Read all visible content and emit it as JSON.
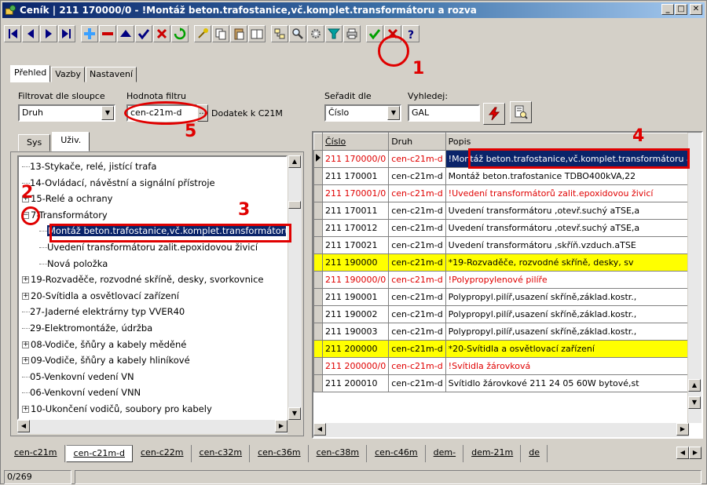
{
  "window": {
    "title": "Ceník | 211 170000/0 - !Montáž beton.trafostanice,vč.komplet.transformátoru a rozva",
    "title_color": "#0a246a",
    "buttons": [
      "minimize",
      "maximize",
      "close"
    ]
  },
  "toolbar": {
    "buttons": [
      {
        "name": "first-record-icon"
      },
      {
        "name": "prev-record-icon"
      },
      {
        "name": "next-record-icon"
      },
      {
        "name": "last-record-icon"
      },
      {
        "name": "add-record-icon"
      },
      {
        "name": "delete-record-icon"
      },
      {
        "name": "up-icon"
      },
      {
        "name": "confirm-icon"
      },
      {
        "name": "cancel-icon"
      },
      {
        "name": "refresh-icon"
      },
      {
        "name": "tool-icon"
      },
      {
        "name": "copy-icon"
      },
      {
        "name": "paste-icon"
      },
      {
        "name": "book-icon"
      },
      {
        "name": "tree-sync-icon"
      },
      {
        "name": "search-icon"
      },
      {
        "name": "settings-icon"
      },
      {
        "name": "filter-icon"
      },
      {
        "name": "print-icon"
      },
      {
        "name": "ok-icon"
      },
      {
        "name": "close-x-icon"
      },
      {
        "name": "help-icon"
      }
    ]
  },
  "annotations": {
    "m1": "1",
    "m2": "2",
    "m3": "3",
    "m4": "4",
    "m5": "5",
    "color": "#e00000"
  },
  "main_tabs": [
    "Přehled",
    "Vazby",
    "Nastavení"
  ],
  "filter": {
    "column_label": "Filtrovat dle sloupce",
    "column_value": "Druh",
    "value_label": "Hodnota filtru",
    "value": "cen-c21m-d",
    "ellipsis": "...",
    "note": "Dodatek k C21M",
    "sort_label": "Seřadit dle",
    "sort_value": "Číslo",
    "search_label": "Vyhledej:",
    "search_value": "GAL"
  },
  "left_tabs": [
    "Sys",
    "Uživ."
  ],
  "tree": [
    {
      "level": 1,
      "text": "13-Stykače, relé, jistící trafa",
      "exp": ""
    },
    {
      "level": 1,
      "text": "14-Ovládací, návěstní a signální přístroje",
      "exp": ""
    },
    {
      "level": 1,
      "text": "15-Relé a ochrany",
      "exp": "+"
    },
    {
      "level": 1,
      "text": "7-Transformátory",
      "exp": "−"
    },
    {
      "level": 2,
      "text": "Montáž beton.trafostanice,vč.komplet.transformátoru",
      "exp": "",
      "selected": true
    },
    {
      "level": 2,
      "text": "Uvedení transformátoru zalit.epoxidovou živicí",
      "exp": ""
    },
    {
      "level": 2,
      "text": "Nová položka",
      "exp": ""
    },
    {
      "level": 1,
      "text": "19-Rozvaděče, rozvodné skříně, desky, svorkovnice",
      "exp": "+"
    },
    {
      "level": 1,
      "text": "20-Svítidla a osvětlovací zařízení",
      "exp": "+"
    },
    {
      "level": 1,
      "text": "27-Jaderné elektrárny typ VVER40",
      "exp": ""
    },
    {
      "level": 1,
      "text": "29-Elektromontáže, údržba",
      "exp": ""
    },
    {
      "level": 1,
      "text": "08-Vodiče, šňůry a kabely měděné",
      "exp": "+"
    },
    {
      "level": 1,
      "text": "09-Vodiče, šňůry a kabely hliníkové",
      "exp": "+"
    },
    {
      "level": 1,
      "text": "05-Venkovní vedení VN",
      "exp": ""
    },
    {
      "level": 1,
      "text": "06-Venkovní vedení VNN",
      "exp": ""
    },
    {
      "level": 1,
      "text": "10-Ukončení vodičů, soubory pro kabely",
      "exp": "+"
    }
  ],
  "grid": {
    "columns": [
      "Číslo",
      "Druh",
      "Popis"
    ],
    "rows": [
      {
        "cislo": "211 170000/0",
        "druh": "cen-c21m-d",
        "popis": "!Montáž beton.trafostanice,vč.komplet.transformátoru a rozva",
        "style": "red",
        "current": true,
        "selected_popis": true
      },
      {
        "cislo": "211 170001",
        "druh": "cen-c21m-d",
        "popis": "Montáž beton.trafostanice TDBO400kVA,22",
        "style": ""
      },
      {
        "cislo": "211 170001/0",
        "druh": "cen-c21m-d",
        "popis": "!Uvedení transformátorů zalit.epoxidovou živicí",
        "style": "red"
      },
      {
        "cislo": "211 170011",
        "druh": "cen-c21m-d",
        "popis": "Uvedení transformátoru ,otevř.suchý aTSE,a",
        "style": ""
      },
      {
        "cislo": "211 170012",
        "druh": "cen-c21m-d",
        "popis": "Uvedení transformátoru ,otevř.suchý aTSE,a",
        "style": ""
      },
      {
        "cislo": "211 170021",
        "druh": "cen-c21m-d",
        "popis": "Uvedení transformátoru ,skříň.vzduch.aTSE",
        "style": ""
      },
      {
        "cislo": "211 190000",
        "druh": "cen-c21m-d",
        "popis": "*19-Rozvaděče, rozvodné skříně, desky, sv",
        "style": "yellow"
      },
      {
        "cislo": "211 190000/0",
        "druh": "cen-c21m-d",
        "popis": "!Polypropylenové pilíře",
        "style": "red"
      },
      {
        "cislo": "211 190001",
        "druh": "cen-c21m-d",
        "popis": "Polypropyl.pilíř,usazení skříně,základ.kostr.,",
        "style": ""
      },
      {
        "cislo": "211 190002",
        "druh": "cen-c21m-d",
        "popis": "Polypropyl.pilíř,usazení skříně,základ.kostr.,",
        "style": ""
      },
      {
        "cislo": "211 190003",
        "druh": "cen-c21m-d",
        "popis": "Polypropyl.pilíř,usazení skříně,základ.kostr.,",
        "style": ""
      },
      {
        "cislo": "211 200000",
        "druh": "cen-c21m-d",
        "popis": "*20-Svítidla a osvětlovací zařízení",
        "style": "yellow"
      },
      {
        "cislo": "211 200000/0",
        "druh": "cen-c21m-d",
        "popis": "!Svítidla žárovková",
        "style": "red"
      },
      {
        "cislo": "211 200010",
        "druh": "cen-c21m-d",
        "popis": "Svítidlo žárovkové 211 24 05 60W bytové,st",
        "style": ""
      }
    ]
  },
  "bottom_tabs": [
    "cen-c21m",
    "cen-c21m-d",
    "cen-c22m",
    "cen-c32m",
    "cen-c36m",
    "cen-c38m",
    "cen-c46m",
    "dem-",
    "dem-21m",
    "de"
  ],
  "bottom_active": "cen-c21m-d",
  "status": {
    "count": "0/269"
  }
}
